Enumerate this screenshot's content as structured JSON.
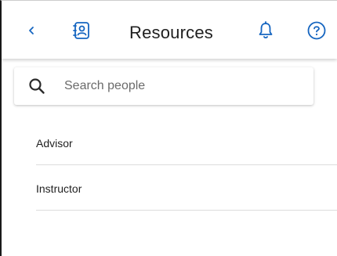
{
  "header": {
    "title": "Resources",
    "icons": {
      "back": "chevron-left-icon",
      "contacts": "contact-book-icon",
      "notifications": "bell-icon",
      "help": "help-circle-icon"
    },
    "accent_color": "#1565c0"
  },
  "search": {
    "placeholder": "Search people",
    "value": ""
  },
  "list": {
    "items": [
      {
        "label": "Advisor"
      },
      {
        "label": "Instructor"
      }
    ]
  }
}
